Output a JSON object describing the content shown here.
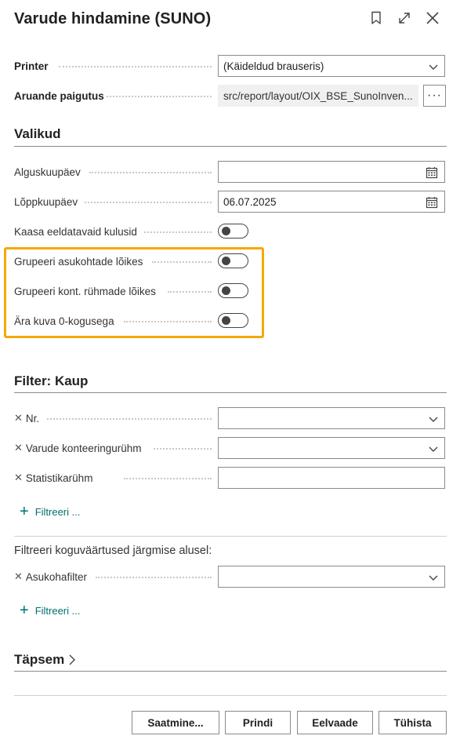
{
  "header": {
    "title": "Varude hindamine (SUNO)"
  },
  "printer": {
    "label": "Printer",
    "value": "(Käideldud brauseris)"
  },
  "layout": {
    "label": "Aruande paigutus",
    "value": "src/report/layout/OIX_BSE_SunoInven...",
    "more_button": "···"
  },
  "options": {
    "title": "Valikud",
    "start_date": {
      "label": "Alguskuupäev",
      "value": ""
    },
    "end_date": {
      "label": "Lõppkuupäev",
      "value": "06.07.2025"
    },
    "include_expected_costs": {
      "label": "Kaasa eeldatavaid kulusid",
      "on": false
    },
    "group_by_location": {
      "label": "Grupeeri asukohtade lõikes",
      "on": false
    },
    "group_by_posting_group": {
      "label": "Grupeeri kont. rühmade lõikes",
      "on": false
    },
    "hide_zero_qty": {
      "label": "Ära kuva 0-kogusega",
      "on": false
    }
  },
  "filter_item": {
    "title": "Filter: Kaup",
    "rows": [
      {
        "label": "Nr.",
        "value": ""
      },
      {
        "label": "Varude konteeringurühm",
        "value": ""
      },
      {
        "label": "Statistikarühm",
        "value": ""
      }
    ],
    "add_filter": "Filtreeri ..."
  },
  "filter_totals": {
    "title": "Filtreeri koguväärtused järgmise alusel:",
    "rows": [
      {
        "label": "Asukohafilter",
        "value": ""
      }
    ],
    "add_filter": "Filtreeri ..."
  },
  "advanced": {
    "label": "Täpsem"
  },
  "footer": {
    "send": "Saatmine...",
    "print": "Prindi",
    "preview": "Eelvaade",
    "cancel": "Tühista"
  },
  "colors": {
    "highlight": "#f6a800",
    "link": "#00706e"
  }
}
